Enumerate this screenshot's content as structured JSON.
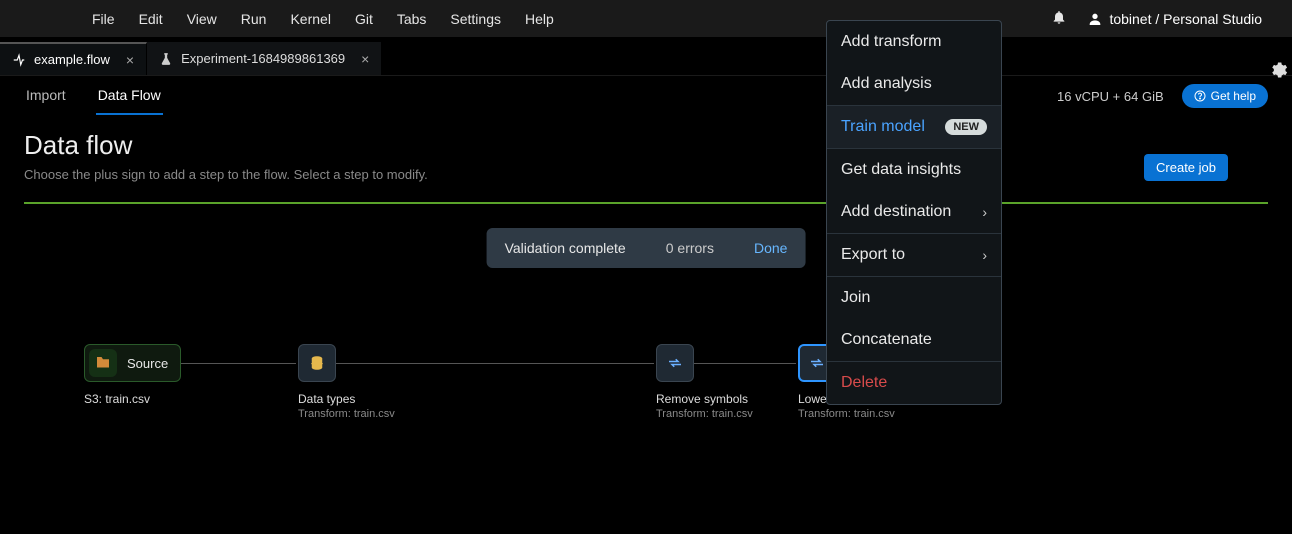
{
  "menubar": {
    "items": [
      "File",
      "Edit",
      "View",
      "Run",
      "Kernel",
      "Git",
      "Tabs",
      "Settings",
      "Help"
    ],
    "user": "tobinet / Personal Studio"
  },
  "file_tabs": [
    {
      "label": "example.flow",
      "kind": "flow",
      "active": true
    },
    {
      "label": "Experiment-1684989861369",
      "kind": "experiment",
      "active": false
    }
  ],
  "subnav": {
    "items": [
      "Import",
      "Data Flow"
    ],
    "active_index": 1
  },
  "resources": "16 vCPU + 64 GiB",
  "get_help": "Get help",
  "page": {
    "title": "Data flow",
    "description": "Choose the plus sign to add a step to the flow. Select a step to modify.",
    "create_job": "Create job"
  },
  "validation": {
    "status": "Validation complete",
    "errors": "0 errors",
    "done": "Done"
  },
  "flow_nodes": {
    "source": {
      "label": "Source",
      "caption": "S3: train.csv"
    },
    "datatypes": {
      "caption": "Data types",
      "sub": "Transform: train.csv"
    },
    "remove": {
      "caption": "Remove symbols",
      "sub": "Transform: train.csv"
    },
    "lower": {
      "caption": "Lower case",
      "sub": "Transform: train.csv"
    }
  },
  "context_menu": {
    "add_transform": "Add transform",
    "add_analysis": "Add analysis",
    "train_model": "Train model",
    "train_badge": "NEW",
    "get_data_insights": "Get data insights",
    "add_destination": "Add destination",
    "export_to": "Export to",
    "join": "Join",
    "concatenate": "Concatenate",
    "delete": "Delete"
  }
}
